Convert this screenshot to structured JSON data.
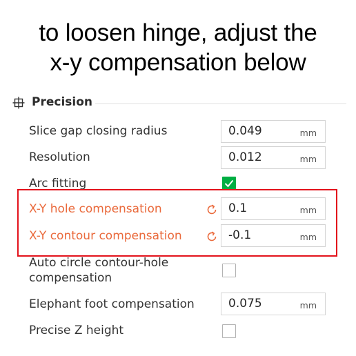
{
  "caption": {
    "line1": "to loosen hinge, adjust the",
    "line2": "x-y compensation below"
  },
  "section": {
    "title": "Precision",
    "icon": "precision-grid-icon"
  },
  "settings": [
    {
      "label": "Slice gap closing radius",
      "type": "number",
      "value": "0.049",
      "unit": "mm"
    },
    {
      "label": "Resolution",
      "type": "number",
      "value": "0.012",
      "unit": "mm"
    },
    {
      "label": "Arc fitting",
      "type": "checkbox",
      "checked": true
    },
    {
      "label": "X-Y hole compensation",
      "type": "number",
      "value": "0.1",
      "unit": "mm",
      "modified": true,
      "reset_icon": "undo-icon"
    },
    {
      "label": "X-Y contour compensation",
      "type": "number",
      "value": "-0.1",
      "unit": "mm",
      "modified": true,
      "reset_icon": "undo-icon"
    },
    {
      "label": "Auto circle contour-hole compensation",
      "type": "checkbox",
      "checked": false
    },
    {
      "label": "Elephant foot compensation",
      "type": "number",
      "value": "0.075",
      "unit": "mm"
    },
    {
      "label": "Precise Z height",
      "type": "checkbox",
      "checked": false
    }
  ],
  "colors": {
    "modified_label": "#ea6a3c",
    "highlight_box": "#e3121b",
    "checkbox_checked": "#00ae42"
  }
}
